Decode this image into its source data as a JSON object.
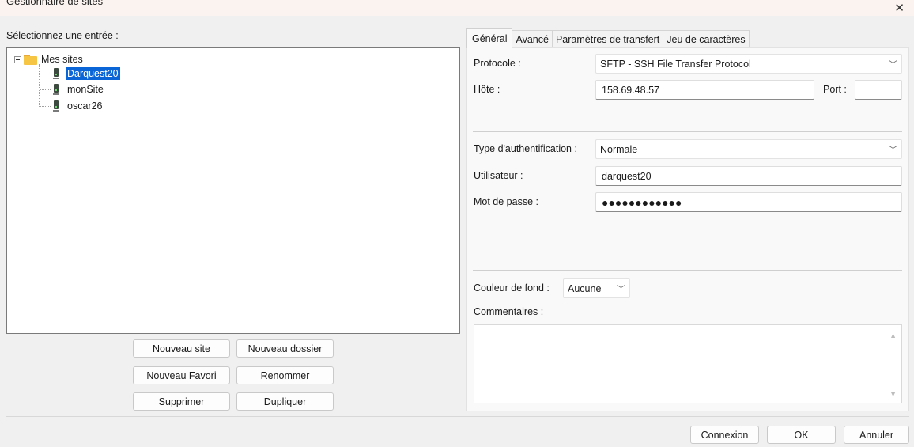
{
  "window": {
    "title": "Gestionnaire de sites",
    "close_glyph": "✕"
  },
  "left": {
    "select_label": "Sélectionnez une entrée :",
    "tree": {
      "root": "Mes sites",
      "items": [
        {
          "label": "Darquest20",
          "selected": true
        },
        {
          "label": "monSite",
          "selected": false
        },
        {
          "label": "oscar26",
          "selected": false
        }
      ]
    },
    "buttons": {
      "new_site": "Nouveau site",
      "new_folder": "Nouveau dossier",
      "new_bookmark": "Nouveau Favori",
      "rename": "Renommer",
      "delete": "Supprimer",
      "duplicate": "Dupliquer"
    }
  },
  "tabs": [
    {
      "label": "Général",
      "active": true
    },
    {
      "label": "Avancé",
      "active": false
    },
    {
      "label": "Paramètres de transfert",
      "active": false
    },
    {
      "label": "Jeu de caractères",
      "active": false
    }
  ],
  "general": {
    "protocol_label": "Protocole :",
    "protocol_value": "SFTP - SSH File Transfer Protocol",
    "host_label": "Hôte :",
    "host_value": "158.69.48.57",
    "port_label": "Port :",
    "port_value": "",
    "auth_label": "Type d'authentification :",
    "auth_value": "Normale",
    "user_label": "Utilisateur :",
    "user_value": "darquest20",
    "password_label": "Mot de passe :",
    "password_value": "●●●●●●●●●●●●",
    "bgcolor_label": "Couleur de fond :",
    "bgcolor_value": "Aucune",
    "comments_label": "Commentaires :",
    "comments_value": ""
  },
  "footer": {
    "connect": "Connexion",
    "ok": "OK",
    "cancel": "Annuler"
  },
  "icons": {
    "close": "close-icon",
    "folder": "folder-icon",
    "server": "server-icon",
    "chevron": "chevron-down-icon"
  },
  "colors": {
    "selection": "#0a66d6",
    "folder": "#f6c544"
  }
}
